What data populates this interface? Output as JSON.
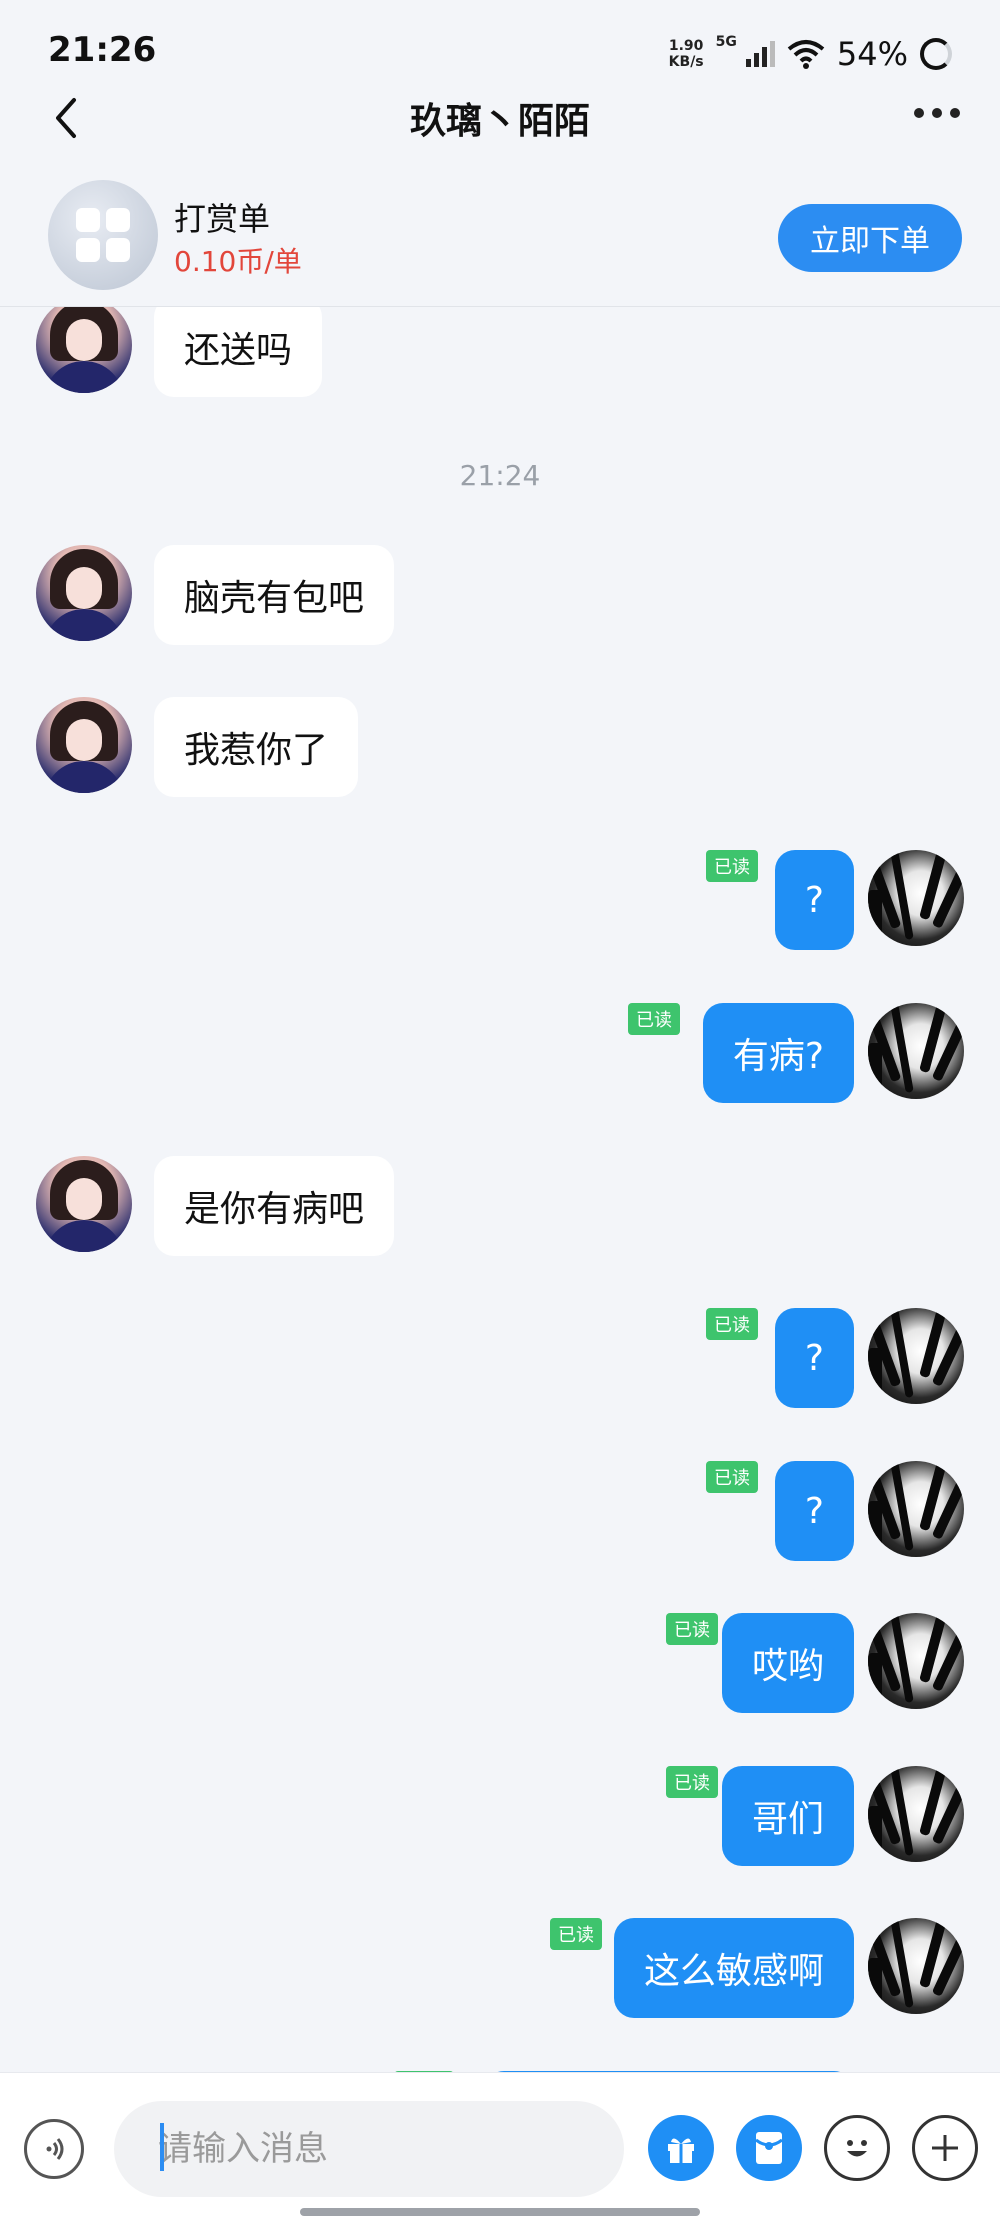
{
  "status_bar": {
    "time": "21:26",
    "net_speed_value": "1.90",
    "net_speed_unit": "KB/s",
    "network": "5G",
    "battery": "54%"
  },
  "header": {
    "title": "玖璃丶陌陌",
    "back_icon": "chevron-left-icon",
    "more_icon": "more-horizontal-icon"
  },
  "order": {
    "title": "打赏单",
    "price": "0.10币/单",
    "button_label": "立即下单",
    "icon": "apps-grid-icon"
  },
  "messages": [
    {
      "side": "in",
      "text": "还送吗"
    },
    {
      "type": "time",
      "text": "21:24"
    },
    {
      "side": "in",
      "text": "脑壳有包吧"
    },
    {
      "side": "in",
      "text": "我惹你了"
    },
    {
      "side": "out",
      "text": "?",
      "read": "已读"
    },
    {
      "side": "out",
      "text": "有病?",
      "read": "已读"
    },
    {
      "side": "in",
      "text": "是你有病吧"
    },
    {
      "side": "out",
      "text": "?",
      "read": "已读"
    },
    {
      "side": "out",
      "text": "?",
      "read": "已读"
    },
    {
      "side": "out",
      "text": "哎哟",
      "read": "已读"
    },
    {
      "side": "out",
      "text": "哥们",
      "read": "已读"
    },
    {
      "side": "out",
      "text": "这么敏感啊",
      "read": "已读"
    }
  ],
  "input": {
    "placeholder": "请输入消息",
    "voice_icon": "voice-icon",
    "gift_icon": "gift-icon",
    "redpacket_icon": "red-packet-icon",
    "emoji_icon": "emoji-icon",
    "plus_icon": "plus-icon"
  },
  "colors": {
    "accent": "#1f8ff5",
    "read_badge": "#3ec46d",
    "price_red": "#e2463b",
    "background": "#f3f5f9"
  }
}
